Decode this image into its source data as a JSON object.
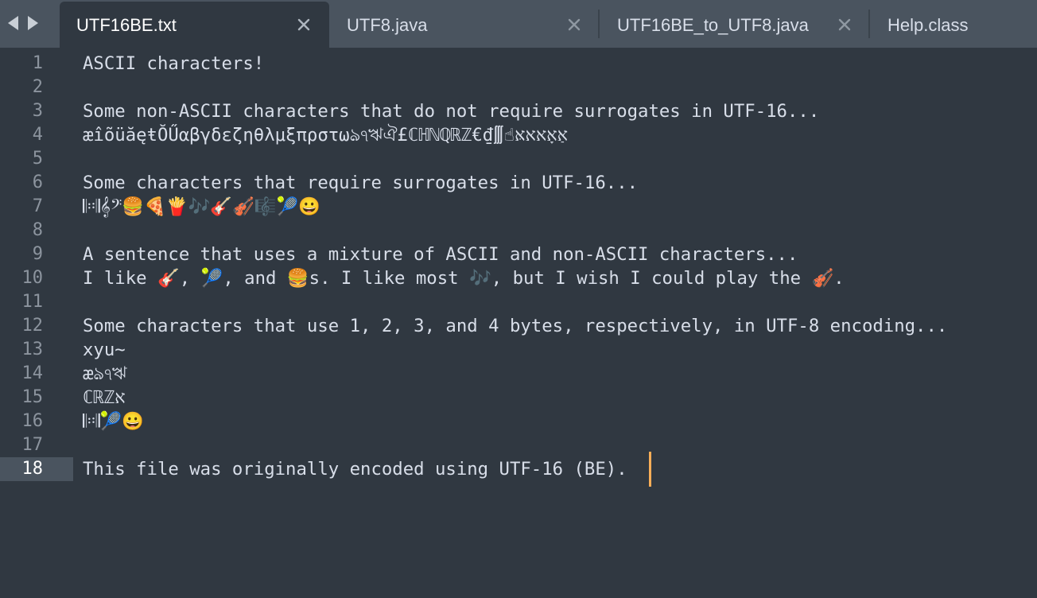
{
  "tabs": [
    {
      "label": "UTF16BE.txt",
      "active": true
    },
    {
      "label": "UTF8.java",
      "active": false
    },
    {
      "label": "UTF16BE_to_UTF8.java",
      "active": false
    },
    {
      "label": "Help.class",
      "active": false
    }
  ],
  "icons": {
    "back": "triangle-left-icon",
    "forward": "triangle-right-icon",
    "close": "close-x-icon"
  },
  "colors": {
    "editor_background": "#303841",
    "tabbar_background": "#4a545f",
    "text": "#d8dee9",
    "line_number": "#8c949e",
    "caret": "#f9ae58"
  },
  "editor": {
    "current_line": 18,
    "lines": [
      {
        "number": "1",
        "text": "ASCII characters!"
      },
      {
        "number": "2",
        "text": ""
      },
      {
        "number": "3",
        "text": "Some non-ASCII characters that do not require surrogates in UTF-16..."
      },
      {
        "number": "4",
        "text": "æîõüăęŧŎŰαβγδεζηθλμξπρστωঌঀঋঐ£ℂℍℕℚℝℤ€₫∭☝אַאָאאאּ"
      },
      {
        "number": "5",
        "text": ""
      },
      {
        "number": "6",
        "text": "Some characters that require surrogates in UTF-16..."
      },
      {
        "number": "7",
        "text": "𝄆𝄇𝄞𝄢🍔🍕🍟🎶🎸🎻🎼🎾😀"
      },
      {
        "number": "8",
        "text": ""
      },
      {
        "number": "9",
        "text": "A sentence that uses a mixture of ASCII and non-ASCII characters..."
      },
      {
        "number": "10",
        "text": "I like 🎸, 🎾, and 🍔s. I like most 🎶, but I wish I could play the 🎻."
      },
      {
        "number": "11",
        "text": ""
      },
      {
        "number": "12",
        "text": "Some characters that use 1, 2, 3, and 4 bytes, respectively, in UTF-8 encoding..."
      },
      {
        "number": "13",
        "text": "xyu~"
      },
      {
        "number": "14",
        "text": "æঌঀঋ"
      },
      {
        "number": "15",
        "text": "ℂℝℤא"
      },
      {
        "number": "16",
        "text": "𝄆𝄇🎾😀"
      },
      {
        "number": "17",
        "text": ""
      },
      {
        "number": "18",
        "text": "This file was originally encoded using UTF-16 (BE)."
      }
    ]
  }
}
